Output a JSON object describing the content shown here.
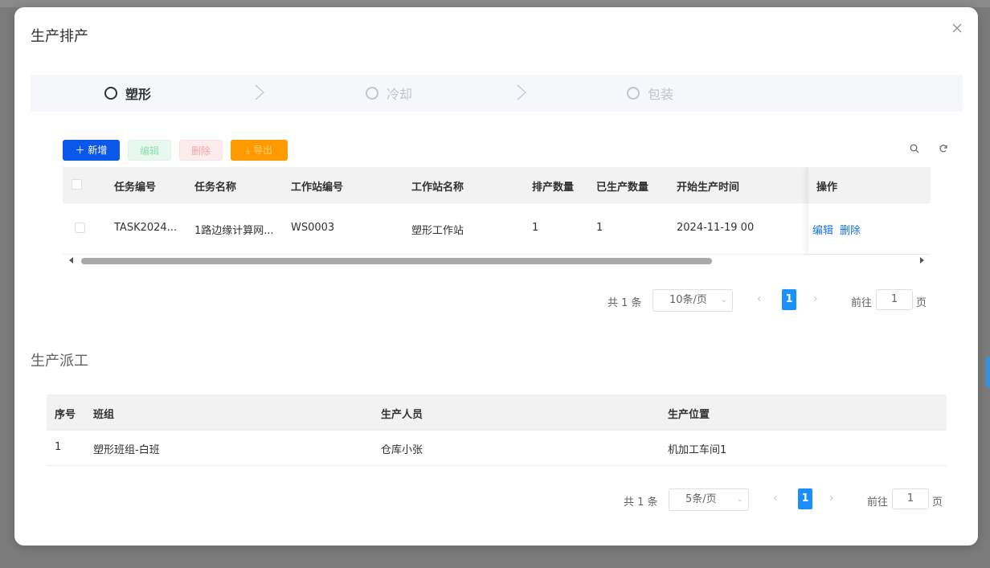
{
  "dialog": {
    "title": "生产排产",
    "close_icon": "close-icon"
  },
  "steps": [
    {
      "label": "塑形",
      "state": "active"
    },
    {
      "label": "冷却",
      "state": "inactive"
    },
    {
      "label": "包装",
      "state": "inactive"
    }
  ],
  "toolbar": {
    "add_label": "新增",
    "edit_label": "编辑",
    "delete_label": "删除",
    "export_label": "导出",
    "search_icon": "search-icon",
    "refresh_icon": "refresh-icon"
  },
  "table1": {
    "columns": [
      "任务编号",
      "任务名称",
      "工作站编号",
      "工作站名称",
      "排产数量",
      "已生产数量",
      "开始生产时间",
      "操作"
    ],
    "rows": [
      {
        "task_no": "TASK2024...",
        "task_name": "1路边缘计算网...",
        "station_no": "WS0003",
        "station_name": "塑形工作站",
        "plan_qty": "1",
        "produced_qty": "1",
        "start_time": "2024-11-19 00",
        "edit": "编辑",
        "delete": "删除"
      }
    ]
  },
  "pager1": {
    "total": "共 1 条",
    "page_size": "10条/页",
    "current_page": "1",
    "goto_label": "前往",
    "goto_value": "1",
    "page_word": "页"
  },
  "section2": {
    "title": "生产派工"
  },
  "table2": {
    "columns": [
      "序号",
      "班组",
      "生产人员",
      "生产位置"
    ],
    "rows": [
      {
        "index": "1",
        "team": "塑形班组-白班",
        "worker": "仓库小张",
        "location": "机加工车间1"
      }
    ]
  },
  "pager2": {
    "total": "共 1 条",
    "page_size": "5条/页",
    "current_page": "1",
    "goto_label": "前往",
    "goto_value": "1",
    "page_word": "页"
  }
}
